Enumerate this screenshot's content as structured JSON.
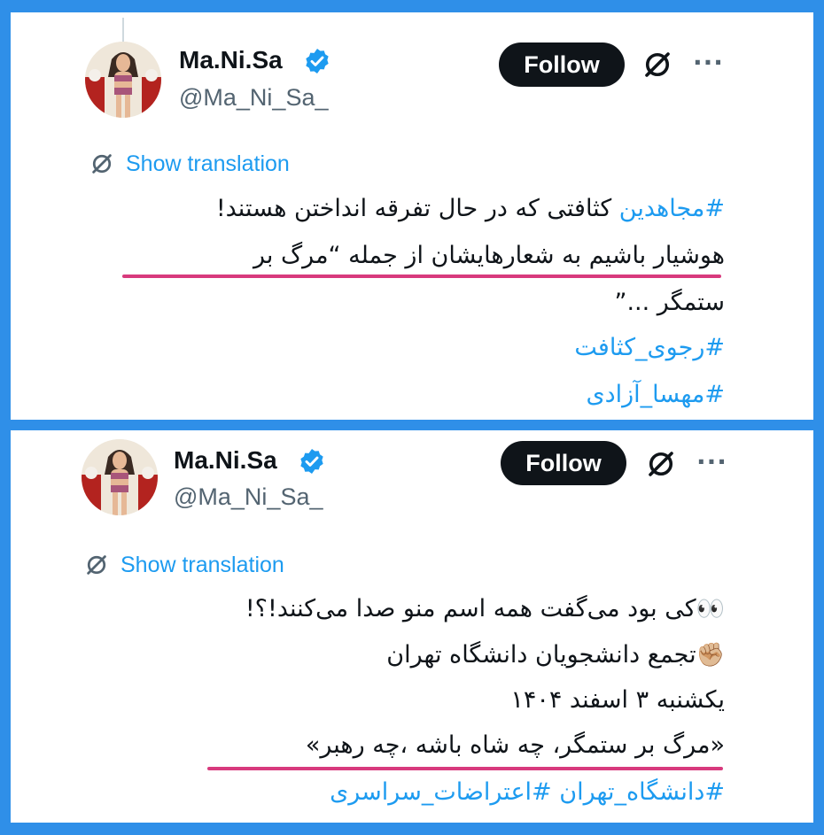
{
  "colors": {
    "accent": "#1d9bf0",
    "underline": "#d83a7d",
    "frame": "#2f8fe8",
    "button_bg": "#0f1419"
  },
  "tweets": [
    {
      "author": {
        "name": "Ma.Ni.Sa",
        "handle": "@Ma_Ni_Sa_",
        "verified_icon": "verified-badge-icon",
        "avatar_icon": "avatar-illustration"
      },
      "follow_label": "Follow",
      "grok_icon": "slashed-circle-icon",
      "more_label": "···",
      "translation_label": "Show translation",
      "lines": {
        "l1_hashtag": "#مجاهدین",
        "l1_text": " کثافتی که در حال تفرقه انداختن هستند!",
        "l2": "هوشیار باشیم به شعارهایشان از جمله “مرگ بر",
        "l3": "ستمگر ...”",
        "l4": "#رجوی_کثافت",
        "l5": "#مهسا_آزادی"
      }
    },
    {
      "author": {
        "name": "Ma.Ni.Sa",
        "handle": "@Ma_Ni_Sa_",
        "verified_icon": "verified-badge-icon",
        "avatar_icon": "avatar-illustration"
      },
      "follow_label": "Follow",
      "grok_icon": "slashed-circle-icon",
      "more_label": "···",
      "translation_label": "Show translation",
      "lines": {
        "l1_emoji": "👀",
        "l1_text": "کی بود می‌گفت همه اسم منو صدا می‌کنند!؟!",
        "l2_emoji": "✊🏼",
        "l2_text": "تجمع دانشجویان دانشگاه تهران",
        "l3": "یکشنبه ۳ اسفند ۱۴۰۴",
        "l4": "«مرگ بر ستمگر، چه شاه باشه ،چه رهبر»",
        "l5": "#دانشگاه_تهران #اعتراضات_سراسری"
      }
    }
  ]
}
